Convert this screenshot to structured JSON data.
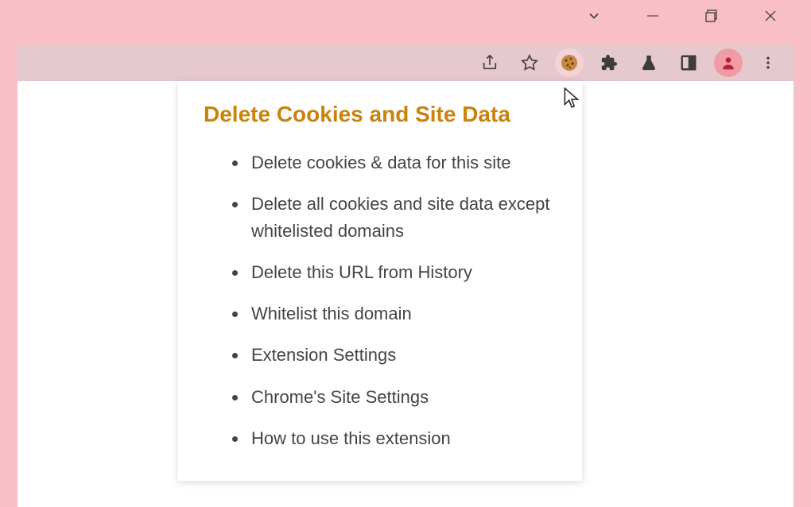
{
  "window": {
    "dropdown_icon": "chevron-down",
    "minimize_icon": "minimize",
    "maximize_icon": "maximize",
    "close_icon": "close"
  },
  "toolbar": {
    "share_icon": "share",
    "bookmark_icon": "star-outline",
    "cookie_ext_icon": "cookie",
    "extensions_icon": "puzzle-piece",
    "labs_icon": "flask",
    "sidepanel_icon": "sidepanel",
    "profile_icon": "person",
    "menu_icon": "more-vertical"
  },
  "popup": {
    "title": "Delete Cookies and Site Data",
    "items": [
      "Delete cookies & data for this site",
      "Delete all cookies and site data except whitelisted domains",
      "Delete this URL from History",
      "Whitelist this domain",
      "Extension Settings",
      "Chrome's Site Settings",
      "How to use this extension"
    ]
  },
  "colors": {
    "accent_title": "#c9830d",
    "body_bg": "#f9bfc7",
    "toolbar_bg": "#e6c9ce",
    "toolbar_active_bg": "#f3d2d8"
  }
}
